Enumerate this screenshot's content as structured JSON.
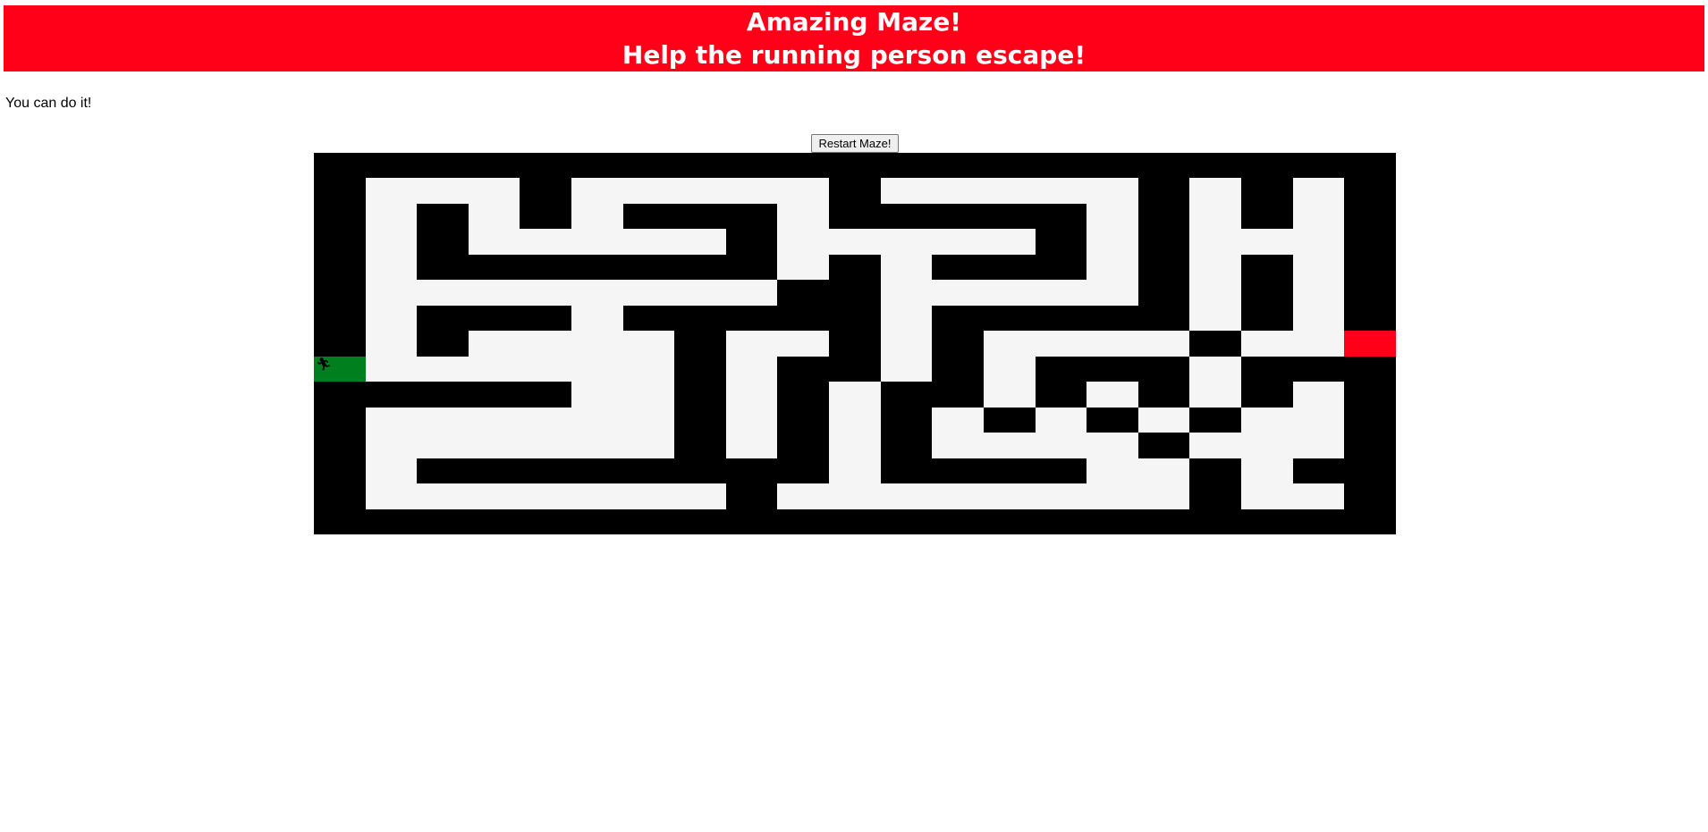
{
  "header": {
    "title": "Amazing Maze!",
    "subtitle": "Help the running person escape!",
    "background_color": "#ff0018"
  },
  "tagline": "You can do it!",
  "restart_label": "Restart Maze!",
  "maze": {
    "player_icon": "running-person-icon",
    "colors": {
      "wall": "#000000",
      "path": "#f5f5f5",
      "start": "#007f1f",
      "exit": "#ff0018"
    },
    "grid": [
      "WWWWWWWWWWWWWWWWWWWWW",
      "WPPPWPPPPPWPPPPPWPWPW",
      "WPWPWPWWWPWWWWWPWPWPW",
      "WPWPPPPPWPPPPPWPWPPPW",
      "WPWWWWWWWPWPWWWPWPWPW",
      "WPPPPPPPPWWPPPPPWPWPW",
      "WPWWWPWWWWWPWWWWWPWPW",
      "WPWPPPPWPPWPWPPPPWPPE",
      "SPPPPPPWPWWPWPWWWPWWW",
      "WWWWWPPWPWPWWPWPWPWPW",
      "WPPPPPPWPWPWPWPWPWPPW",
      "WPPPPPPWPWPWPPPPWPPPW",
      "WPWWWWWWWWPWWWWPPWPWW",
      "WPPPPPPPWPPPPPPPPWPPW",
      "WWWWWWWWWWWWWWWWWWWWW"
    ]
  }
}
